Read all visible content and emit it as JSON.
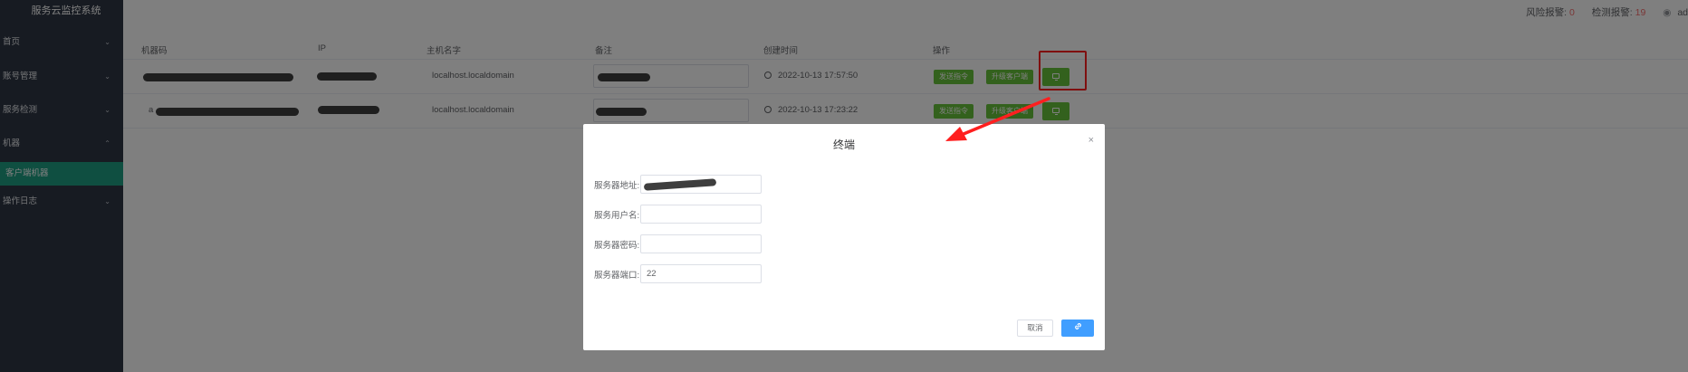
{
  "app": {
    "title": "服务云监控系统"
  },
  "sidebar": {
    "items": [
      {
        "label": "首页",
        "chevron": "⌄"
      },
      {
        "label": "账号管理",
        "chevron": "⌄"
      },
      {
        "label": "服务检测",
        "chevron": "⌄"
      },
      {
        "label": "机器",
        "chevron": "⌃"
      },
      {
        "label": "客户端机器",
        "chevron": ""
      },
      {
        "label": "操作日志",
        "chevron": "⌄"
      }
    ]
  },
  "header": {
    "risk_label": "风险报警:",
    "risk_count": "0",
    "detect_label": "检测报警:",
    "detect_count": "19",
    "user": "ad"
  },
  "table": {
    "columns": [
      "机器码",
      "IP",
      "主机名字",
      "备注",
      "创建时间",
      "操作"
    ],
    "rows": [
      {
        "machine_code": "",
        "ip": "",
        "hostname": "localhost.localdomain",
        "note": "",
        "created": "2022-10-13 17:57:50",
        "btn_send": "发送指令",
        "btn_upgrade": "升级客户端"
      },
      {
        "machine_code": "a",
        "ip": "",
        "hostname": "localhost.localdomain",
        "note": "",
        "created": "2022-10-13 17:23:22",
        "btn_send": "发送指令",
        "btn_upgrade": "升级客户端"
      }
    ]
  },
  "modal": {
    "title": "终端",
    "close": "×",
    "fields": [
      {
        "label": "服务器地址:",
        "value": ""
      },
      {
        "label": "服务用户名:",
        "value": ""
      },
      {
        "label": "服务器密码:",
        "value": ""
      },
      {
        "label": "服务器端口:",
        "value": "22"
      }
    ],
    "cancel_label": "取消",
    "confirm_icon": "link-icon"
  },
  "annotation": {
    "arrow_color": "#ff1f1f"
  },
  "colors": {
    "sidebar": "#2f3745",
    "active": "#1f9e82",
    "green": "#67c23a",
    "primary": "#409eff",
    "alert": "#f56c6c"
  }
}
